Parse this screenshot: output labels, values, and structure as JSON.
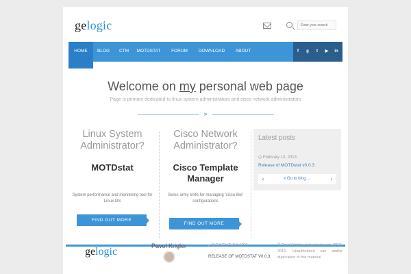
{
  "header": {
    "logo_prefix": "ge",
    "logo_suffix": "logic",
    "search_placeholder": "Enter your search"
  },
  "nav": {
    "items": [
      {
        "label": "HOME",
        "active": true
      },
      {
        "label": "BLOG"
      },
      {
        "label": "CTM"
      },
      {
        "label": "MOTDSTAT"
      },
      {
        "label": "FORUM"
      },
      {
        "label": "DOWNLOAD"
      },
      {
        "label": "ABOUT"
      }
    ],
    "social": [
      {
        "icon": "facebook-icon",
        "glyph": "f"
      },
      {
        "icon": "google-plus-icon",
        "glyph": "g"
      },
      {
        "icon": "twitter-icon",
        "glyph": "t"
      },
      {
        "icon": "youtube-icon",
        "glyph": "▶"
      },
      {
        "icon": "linkedin-icon",
        "glyph": "in"
      }
    ]
  },
  "hero": {
    "title_before": "Welcome on ",
    "title_underlined": "my",
    "title_after": " personal web page",
    "subtitle": "Page is primary dedicated to linux system administrators and cisco network administrators"
  },
  "columns": [
    {
      "question": "Linux System Administrator?",
      "heading": "MOTDstat",
      "text": "System performance and monitoring tool for Linux OS",
      "button": "FIND OUT MORE"
    },
    {
      "question": "Cisco Network Administrator?",
      "heading": "Cisco Template Manager",
      "text": "Swiss army knife for managing 'cisco like' configurations",
      "button": "FIND OUT MORE"
    }
  ],
  "latest": {
    "title": "Latest posts",
    "date": "February 13, 2013",
    "post": "Release of MOTDstat v0.0.3",
    "go_to_blog": "Go to blog →"
  },
  "footer": {
    "logo_prefix": "ge",
    "logo_suffix": "logic",
    "author": "Pavol Krigler",
    "recent_posts": "RECENT POSTS",
    "post": "RELEASE OF MOTDSTAT V0.0.3",
    "copyright": "© Pavol Krigler and gelogic.net, 2012-2015. Unauthorized use and/or duplication of this material"
  },
  "colors": {
    "accent": "#3d95d8",
    "social_bar": "#2b5e8c"
  }
}
